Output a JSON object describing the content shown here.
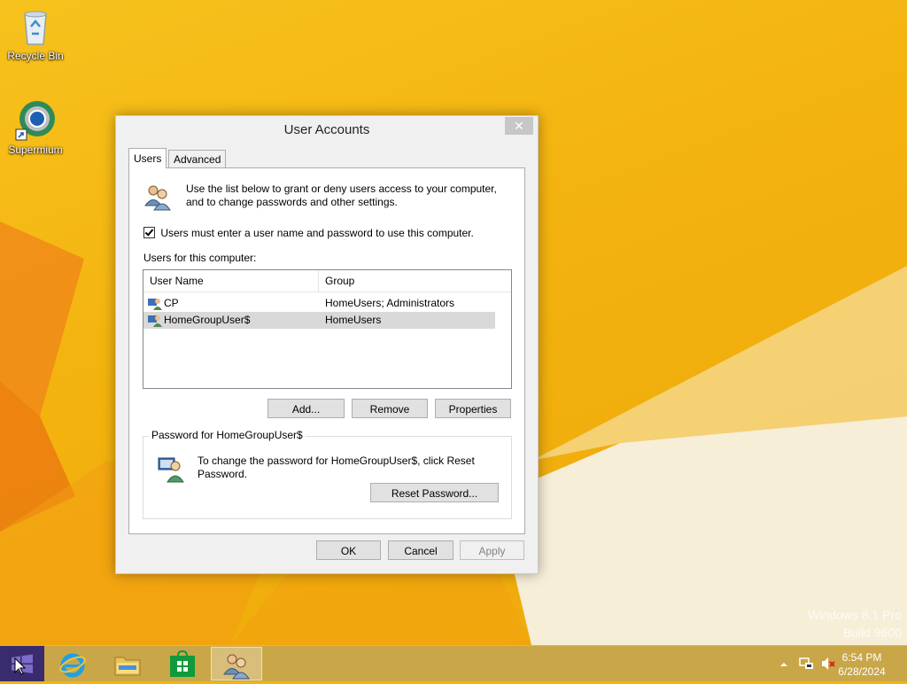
{
  "desktop": {
    "icons": [
      {
        "label": "Recycle Bin",
        "icon": "recycle-bin-icon"
      },
      {
        "label": "Supermium",
        "icon": "supermium-browser-icon"
      }
    ],
    "watermark": {
      "line1": "Windows 8.1 Pro",
      "line2": "Build 9600"
    }
  },
  "dialog": {
    "title": "User Accounts",
    "close_glyph": "✕",
    "tabs": [
      {
        "label": "Users",
        "active": true
      },
      {
        "label": "Advanced",
        "active": false
      }
    ],
    "intro_text": "Use the list below to grant or deny users access to your computer, and to change passwords and other settings.",
    "must_login_checkbox": {
      "label": "Users must enter a user name and password to use this computer.",
      "checked": true
    },
    "users_label": "Users for this computer:",
    "columns": [
      "User Name",
      "Group"
    ],
    "users": [
      {
        "name": "CP",
        "group": "HomeUsers; Administrators",
        "selected": false
      },
      {
        "name": "HomeGroupUser$",
        "group": "HomeUsers",
        "selected": true
      }
    ],
    "buttons": {
      "add": "Add...",
      "remove": "Remove",
      "properties": "Properties"
    },
    "password_group": {
      "legend": "Password for HomeGroupUser$",
      "text": "To change the password for HomeGroupUser$, click Reset Password.",
      "reset_button": "Reset Password..."
    },
    "footer": {
      "ok": "OK",
      "cancel": "Cancel",
      "apply": "Apply",
      "apply_disabled": true
    }
  },
  "taskbar": {
    "items": [
      {
        "name": "start",
        "icon": "windows-start-icon"
      },
      {
        "name": "internet-explorer",
        "icon": "internet-explorer-icon"
      },
      {
        "name": "file-explorer",
        "icon": "folder-icon"
      },
      {
        "name": "store",
        "icon": "store-icon"
      },
      {
        "name": "user-accounts",
        "icon": "user-accounts-icon",
        "active": true
      }
    ],
    "tray": {
      "time": "6:54 PM",
      "date": "6/28/2024"
    }
  }
}
